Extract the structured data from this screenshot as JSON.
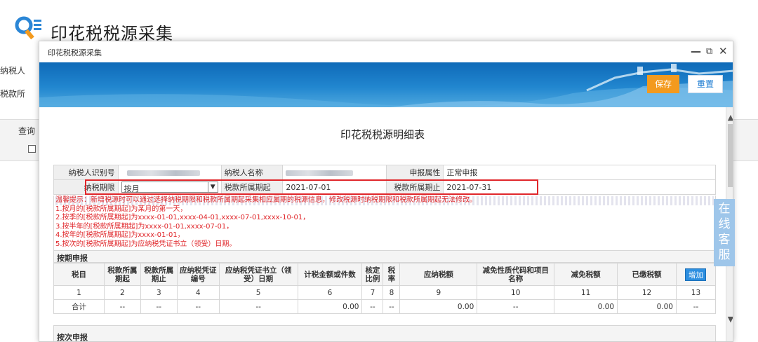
{
  "page": {
    "title": "印花税税源采集",
    "label_taxpayer": "纳税人",
    "label_period": "税款所",
    "label_query": "查询"
  },
  "dialog": {
    "title": "印花税税源采集",
    "controls": {
      "minimize": "—",
      "restore": "⧉",
      "close": "✕"
    },
    "save_label": "保存",
    "reset_label": "重置"
  },
  "doc": {
    "title": "印花税税源明细表",
    "info": {
      "taxpayer_id_label": "纳税人识别号",
      "taxpayer_name_label": "纳税人名称",
      "declare_attr_label": "申报属性",
      "declare_attr_value": "正常申报",
      "period_type_label": "纳税期限",
      "period_type_value": "按月",
      "period_start_label": "税款所属期起",
      "period_start_value": "2021-07-01",
      "period_end_label": "税款所属期止",
      "period_end_value": "2021-07-31"
    },
    "tips": [
      "温馨提示：新增税源时可以通过选择纳税期限和税款所属期起采集相应属期的税源信息，修改税源时纳税期限和税款所属期起无法修改。",
      "1.按月的[税款所属期起]为某月的第一天，",
      "2.按季的[税款所属期起]为xxxx-01-01,xxxx-04-01,xxxx-07-01,xxxx-10-01，",
      "3.按半年的[税款所属期起]为xxxx-01-01,xxxx-07-01，",
      "4.按年的[税款所属期起]为xxxx-01-01，",
      "5.按次的[税款所属期起]为应纳税凭证书立（领受）日期。"
    ],
    "section1": "按期申报",
    "section2": "按次申报",
    "add_label": "增加",
    "headers": [
      "税目",
      "税款所属期起",
      "税款所属期止",
      "应纳税凭证编号",
      "应纳税凭证书立（领受）日期",
      "计税金额或件数",
      "核定比例",
      "税率",
      "应纳税额",
      "减免性质代码和项目名称",
      "减免税额",
      "已缴税额"
    ],
    "index_row": [
      "1",
      "2",
      "3",
      "4",
      "5",
      "6",
      "7",
      "8",
      "9",
      "10",
      "11",
      "12",
      "13"
    ],
    "total_row": [
      "合计",
      "--",
      "--",
      "--",
      "--",
      "0.00",
      "--",
      "--",
      "0.00",
      "--",
      "0.00",
      "0.00",
      "--"
    ]
  },
  "service": {
    "text": "在线客服"
  },
  "colors": {
    "accent_blue": "#1a7ad0",
    "save_orange": "#f39a1e",
    "alert_red": "#e0262a"
  }
}
